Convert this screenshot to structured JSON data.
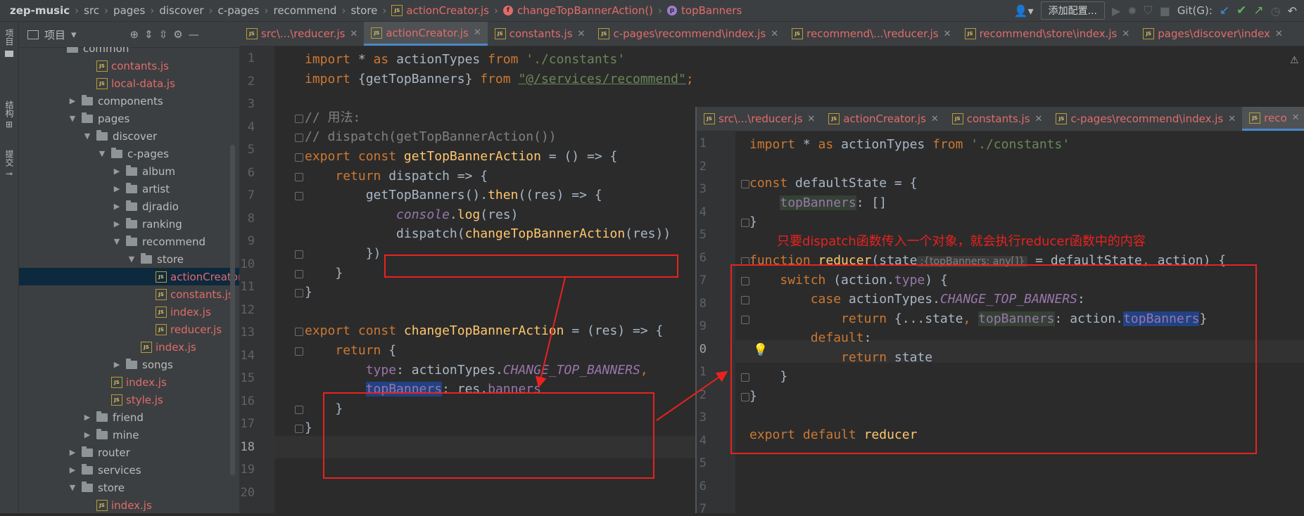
{
  "breadcrumb": {
    "project": "zep-music",
    "items": [
      "src",
      "pages",
      "discover",
      "c-pages",
      "recommend",
      "store"
    ],
    "file": "actionCreator.js",
    "func_badge": "f",
    "func": "changeTopBannerAction()",
    "prop_badge": "p",
    "prop": "topBanners"
  },
  "toolbar": {
    "add_config": "添加配置...",
    "git_label": "Git(G):"
  },
  "side_tabs": {
    "project": "项目",
    "structure": "结构",
    "commit": "提交"
  },
  "project_panel": {
    "title": "项目",
    "tree": [
      {
        "name": "common",
        "type": "folder",
        "indent": 0,
        "arrow": "",
        "color": "normal"
      },
      {
        "name": "contants.js",
        "type": "js",
        "indent": 2,
        "arrow": "",
        "color": "red"
      },
      {
        "name": "local-data.js",
        "type": "js",
        "indent": 2,
        "arrow": "",
        "color": "red"
      },
      {
        "name": "components",
        "type": "folder",
        "indent": 1,
        "arrow": "closed",
        "color": "normal"
      },
      {
        "name": "pages",
        "type": "folder",
        "indent": 1,
        "arrow": "open",
        "color": "normal"
      },
      {
        "name": "discover",
        "type": "folder",
        "indent": 2,
        "arrow": "open",
        "color": "normal"
      },
      {
        "name": "c-pages",
        "type": "folder",
        "indent": 3,
        "arrow": "open",
        "color": "normal"
      },
      {
        "name": "album",
        "type": "folder",
        "indent": 4,
        "arrow": "closed",
        "color": "normal"
      },
      {
        "name": "artist",
        "type": "folder",
        "indent": 4,
        "arrow": "closed",
        "color": "normal"
      },
      {
        "name": "djradio",
        "type": "folder",
        "indent": 4,
        "arrow": "closed",
        "color": "normal"
      },
      {
        "name": "ranking",
        "type": "folder",
        "indent": 4,
        "arrow": "closed",
        "color": "normal"
      },
      {
        "name": "recommend",
        "type": "folder",
        "indent": 4,
        "arrow": "open",
        "color": "normal"
      },
      {
        "name": "store",
        "type": "folder",
        "indent": 5,
        "arrow": "open",
        "color": "normal"
      },
      {
        "name": "actionCreator.js",
        "type": "js",
        "indent": 6,
        "arrow": "",
        "color": "red",
        "selected": true
      },
      {
        "name": "constants.js",
        "type": "js",
        "indent": 6,
        "arrow": "",
        "color": "red"
      },
      {
        "name": "index.js",
        "type": "js",
        "indent": 6,
        "arrow": "",
        "color": "red"
      },
      {
        "name": "reducer.js",
        "type": "js",
        "indent": 6,
        "arrow": "",
        "color": "red"
      },
      {
        "name": "index.js",
        "type": "js",
        "indent": 5,
        "arrow": "",
        "color": "red"
      },
      {
        "name": "songs",
        "type": "folder",
        "indent": 4,
        "arrow": "closed",
        "color": "normal"
      },
      {
        "name": "index.js",
        "type": "js",
        "indent": 3,
        "arrow": "",
        "color": "red"
      },
      {
        "name": "style.js",
        "type": "js",
        "indent": 3,
        "arrow": "",
        "color": "red"
      },
      {
        "name": "friend",
        "type": "folder",
        "indent": 2,
        "arrow": "closed",
        "color": "normal"
      },
      {
        "name": "mine",
        "type": "folder",
        "indent": 2,
        "arrow": "closed",
        "color": "normal"
      },
      {
        "name": "router",
        "type": "folder",
        "indent": 1,
        "arrow": "closed",
        "color": "normal"
      },
      {
        "name": "services",
        "type": "folder",
        "indent": 1,
        "arrow": "closed",
        "color": "normal"
      },
      {
        "name": "store",
        "type": "folder",
        "indent": 1,
        "arrow": "open",
        "color": "normal"
      },
      {
        "name": "index.js",
        "type": "js",
        "indent": 2,
        "arrow": "",
        "color": "red"
      }
    ]
  },
  "main_tabs": [
    {
      "label": "src\\...\\reducer.js",
      "active": false
    },
    {
      "label": "actionCreator.js",
      "active": true
    },
    {
      "label": "constants.js",
      "active": false
    },
    {
      "label": "c-pages\\recommend\\index.js",
      "active": false
    },
    {
      "label": "recommend\\...\\reducer.js",
      "active": false
    },
    {
      "label": "recommend\\store\\index.js",
      "active": false
    },
    {
      "label": "pages\\discover\\index",
      "active": false
    }
  ],
  "main_line_numbers": [
    "1",
    "2",
    "3",
    "4",
    "5",
    "6",
    "7",
    "8",
    "9",
    "10",
    "11",
    "12",
    "13",
    "14",
    "15",
    "16",
    "17",
    "18",
    "19",
    "20"
  ],
  "main_code": [
    [
      [
        "kw",
        "import "
      ],
      [
        "id",
        "* "
      ],
      [
        "kw",
        "as "
      ],
      [
        "id",
        "actionTypes "
      ],
      [
        "kw",
        "from "
      ],
      [
        "str",
        "'./constants'"
      ]
    ],
    [
      [
        "kw",
        "import "
      ],
      [
        "id",
        "{getTopBanners} "
      ],
      [
        "kw",
        "from "
      ],
      [
        "strul",
        "\"@/services/recommend\""
      ],
      [
        "kw",
        ";"
      ]
    ],
    [],
    [
      [
        "cm",
        "// 用法:"
      ]
    ],
    [
      [
        "cm",
        "// dispatch(getTopBannerAction())"
      ]
    ],
    [
      [
        "kw",
        "export const "
      ],
      [
        "fn",
        "getTopBannerAction "
      ],
      [
        "id",
        "= () => {"
      ]
    ],
    [
      [
        "id",
        "    "
      ],
      [
        "kw",
        "return "
      ],
      [
        "id",
        "dispatch => {"
      ]
    ],
    [
      [
        "id",
        "        getTopBanners()."
      ],
      [
        "fn",
        "then"
      ],
      [
        "id",
        "((res) => {"
      ]
    ],
    [
      [
        "id",
        "            "
      ],
      [
        "propi",
        "console"
      ],
      [
        "id",
        "."
      ],
      [
        "fn",
        "log"
      ],
      [
        "id",
        "(res)"
      ]
    ],
    [
      [
        "id",
        "            dispatch("
      ],
      [
        "fn",
        "changeTopBannerAction"
      ],
      [
        "id",
        "(res))"
      ]
    ],
    [
      [
        "id",
        "        })"
      ]
    ],
    [
      [
        "id",
        "    }"
      ]
    ],
    [
      [
        "id",
        "}"
      ]
    ],
    [],
    [
      [
        "kw",
        "export const "
      ],
      [
        "fn",
        "changeTopBannerAction "
      ],
      [
        "id",
        "= (res) => {"
      ]
    ],
    [
      [
        "id",
        "    "
      ],
      [
        "kw",
        "return "
      ],
      [
        "id",
        "{"
      ]
    ],
    [
      [
        "id",
        "        "
      ],
      [
        "prop",
        "type"
      ],
      [
        "id",
        ": actionTypes."
      ],
      [
        "cstc",
        "CHANGE_TOP_BANNERS"
      ],
      [
        "kw",
        ","
      ]
    ],
    [
      [
        "id",
        "        "
      ],
      [
        "hl-sel",
        "topBanners"
      ],
      [
        "id",
        ": res."
      ],
      [
        "prop",
        "banners"
      ]
    ],
    [
      [
        "id",
        "    }"
      ]
    ],
    [
      [
        "id",
        "}"
      ]
    ]
  ],
  "popup_tabs": [
    {
      "label": "src\\...\\reducer.js",
      "active": false
    },
    {
      "label": "actionCreator.js",
      "active": false
    },
    {
      "label": "constants.js",
      "active": false
    },
    {
      "label": "c-pages\\recommend\\index.js",
      "active": false
    },
    {
      "label": "reco",
      "active": true
    }
  ],
  "popup_line_numbers": [
    "1",
    "2",
    "3",
    "4",
    "5",
    "6",
    "7",
    "8",
    "9",
    "0",
    "1",
    "2",
    "3",
    "4",
    "5",
    "6",
    "7"
  ],
  "popup_code": [
    [
      [
        "kw",
        "import "
      ],
      [
        "id",
        "* "
      ],
      [
        "kw",
        "as "
      ],
      [
        "id",
        "actionTypes "
      ],
      [
        "kw",
        "from "
      ],
      [
        "str",
        "'./constants'"
      ]
    ],
    [],
    [
      [
        "kw",
        "const "
      ],
      [
        "id",
        "defaultState = {"
      ]
    ],
    [
      [
        "id",
        "    "
      ],
      [
        "hl-prop",
        "topBanners"
      ],
      [
        "id",
        ": []"
      ]
    ],
    [
      [
        "id",
        "}"
      ]
    ],
    [],
    [
      [
        "kw",
        "function "
      ],
      [
        "fn",
        "reducer"
      ],
      [
        "id",
        "(state"
      ],
      [
        "hint",
        ":{topBanners: any[]}"
      ],
      [
        "id",
        " = defaultState"
      ],
      [
        "kw",
        ", "
      ],
      [
        "id",
        "action) {"
      ]
    ],
    [
      [
        "id",
        "    "
      ],
      [
        "kw",
        "switch "
      ],
      [
        "id",
        "(action."
      ],
      [
        "prop",
        "type"
      ],
      [
        "id",
        ") {"
      ]
    ],
    [
      [
        "id",
        "        "
      ],
      [
        "kw",
        "case "
      ],
      [
        "id",
        "actionTypes."
      ],
      [
        "cstc",
        "CHANGE_TOP_BANNERS"
      ],
      [
        "id",
        ":"
      ]
    ],
    [
      [
        "id",
        "            "
      ],
      [
        "kw",
        "return "
      ],
      [
        "id",
        "{...state"
      ],
      [
        "kw",
        ", "
      ],
      [
        "hl-prop",
        "topBanners"
      ],
      [
        "id",
        ": action."
      ],
      [
        "hl-sel",
        "topBanners"
      ],
      [
        "id",
        "}"
      ]
    ],
    [
      [
        "id",
        "        "
      ],
      [
        "kw",
        "default"
      ],
      [
        "id",
        ":"
      ]
    ],
    [
      [
        "id",
        "            "
      ],
      [
        "kw",
        "return "
      ],
      [
        "id",
        "state"
      ]
    ],
    [
      [
        "id",
        "    }"
      ]
    ],
    [
      [
        "id",
        "}"
      ]
    ],
    [],
    [
      [
        "kw",
        "export default "
      ],
      [
        "fn",
        "reducer"
      ]
    ],
    []
  ],
  "annotation": "只要dispatch函数传入一个对象，就会执行reducer函数中的内容",
  "colors": {
    "annotation_red": "#e8221f",
    "keyword": "#cc7832",
    "string": "#6a8759",
    "function": "#ffc66d",
    "property": "#9876aa"
  }
}
